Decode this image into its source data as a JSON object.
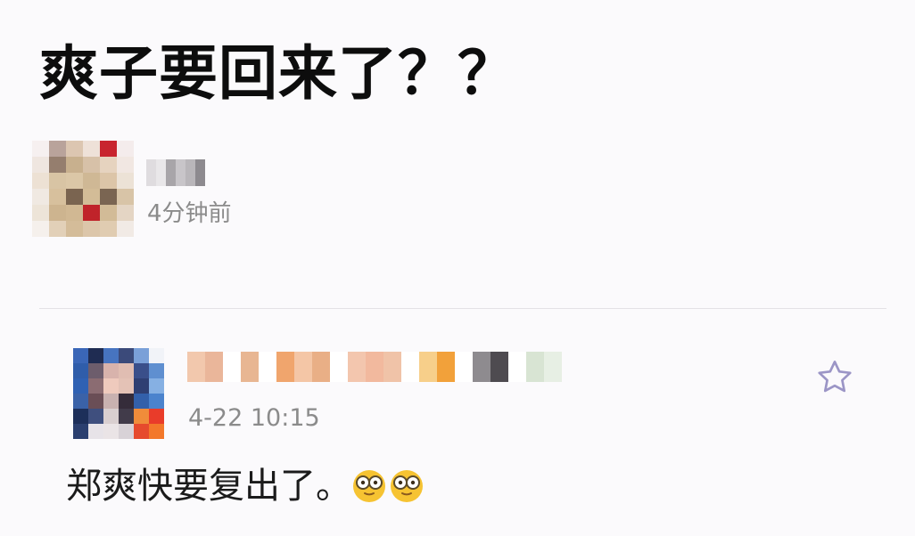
{
  "post": {
    "title": "爽子要回来了？？",
    "author": {
      "avatar_icon": "pixelated-avatar-icon",
      "time": "4分钟前"
    }
  },
  "comment": {
    "author": {
      "avatar_icon": "pixelated-avatar-icon",
      "time": "4-22 10:15"
    },
    "text": "郑爽快要复出了。",
    "emojis": [
      "nerd-glasses-emoji",
      "nerd-glasses-emoji"
    ],
    "favorite_icon": "star-outline-icon"
  },
  "colors": {
    "background": "#fbfafc",
    "title": "#0d0d0d",
    "timestamp": "#8b8b8b",
    "divider": "#e3e1e6",
    "star": "#9b95c6"
  },
  "avatars": {
    "top": [
      "#f6f0f0",
      "#b9a39b",
      "#dcc6b1",
      "#eee1d8",
      "#c8242e",
      "#f4ecec",
      "#efe6e0",
      "#957e6e",
      "#c8b08e",
      "#d7c1a8",
      "#e6d3bf",
      "#f1e7e2",
      "#ede1d4",
      "#d8c4a4",
      "#dbc7a7",
      "#cfb895",
      "#dcc5a8",
      "#ece2d6",
      "#f0e9e2",
      "#d7c09d",
      "#7a6450",
      "#d3bc97",
      "#7a6552",
      "#d8c4a7",
      "#ede4d8",
      "#cdb48f",
      "#d1b893",
      "#c0232a",
      "#d2bb97",
      "#e4d5c4",
      "#f5f0ec",
      "#e2d0b8",
      "#d4bc99",
      "#dcc6aa",
      "#e0ccb1",
      "#f1eae5"
    ],
    "comment": [
      "#3a66b7",
      "#1f2c52",
      "#4774c0",
      "#3b4a7a",
      "#7aa0d8",
      "#f1f3f8",
      "#2f5daa",
      "#6d5d6c",
      "#d8b3ac",
      "#e0bdb2",
      "#3a4f8a",
      "#5f8fd0",
      "#2f61b3",
      "#8b6c72",
      "#efcabd",
      "#e4c2b6",
      "#2f3f72",
      "#86b0e3",
      "#3a62a8",
      "#6a4e56",
      "#c8b1b0",
      "#352c3a",
      "#3360aa",
      "#4b83cd",
      "#1d2f5a",
      "#3f4f7e",
      "#d9cfd0",
      "#413b4a",
      "#f08c3a",
      "#e93c2a",
      "#2b3f6f",
      "#e7e3e8",
      "#eae4e6",
      "#d8d2d7",
      "#e64a2d",
      "#f3782b"
    ]
  },
  "blurred_names": {
    "top": [
      "#dfdcdf",
      "#e9e7e9",
      "#a8a5a9",
      "#c8c5c9",
      "#b9b6ba",
      "#8d8a8f"
    ],
    "comment": [
      "#f2c8ad",
      "#eab69a",
      "#ffffff",
      "#e8b692",
      "#ffffff",
      "#f0a56d",
      "#f4c6a6",
      "#e9af86",
      "#ffffff",
      "#f3c6ae",
      "#f2b99e",
      "#f0c3a8",
      "#ffffff",
      "#f7cf8a",
      "#f2a13a",
      "#ffffff",
      "#8e8b8f",
      "#4e4b50",
      "#ffffff",
      "#d8e4d3",
      "#e7efe4"
    ]
  }
}
